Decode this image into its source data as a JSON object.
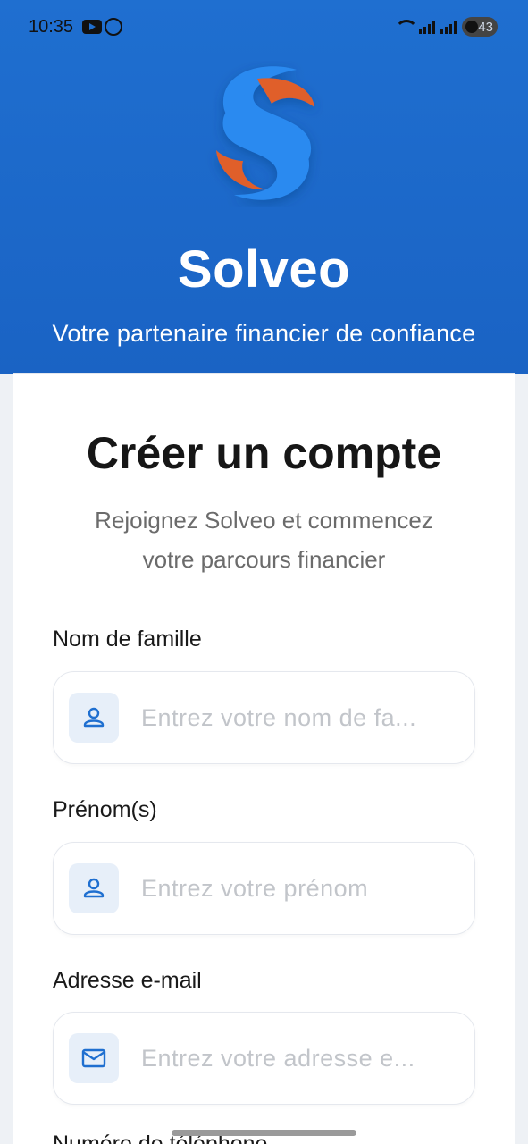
{
  "status_bar": {
    "time": "10:35",
    "battery": "43",
    "icons": [
      "youtube-icon",
      "whatsapp-icon",
      "wifi-icon",
      "signal-icon",
      "battery-icon"
    ]
  },
  "header": {
    "brand_name": "Solveo",
    "tagline": "Votre partenaire financier de confiance",
    "colors": {
      "background": "#1f6fd0",
      "logo_blue": "#2a8af0",
      "logo_orange": "#e05f2a"
    }
  },
  "form": {
    "title": "Créer un compte",
    "subtitle_line1": "Rejoignez Solveo et commencez",
    "subtitle_line2": "votre parcours financier",
    "fields": [
      {
        "label": "Nom de famille",
        "placeholder": "Entrez votre nom de fa...",
        "icon": "user-icon"
      },
      {
        "label": "Prénom(s)",
        "placeholder": "Entrez votre prénom",
        "icon": "user-icon"
      },
      {
        "label": "Adresse e-mail",
        "placeholder": "Entrez votre adresse e...",
        "icon": "mail-icon"
      }
    ],
    "next_label": "Numéro de téléphone",
    "colors": {
      "icon_bg": "#e7eff9",
      "icon": "#1f6fd0"
    }
  }
}
